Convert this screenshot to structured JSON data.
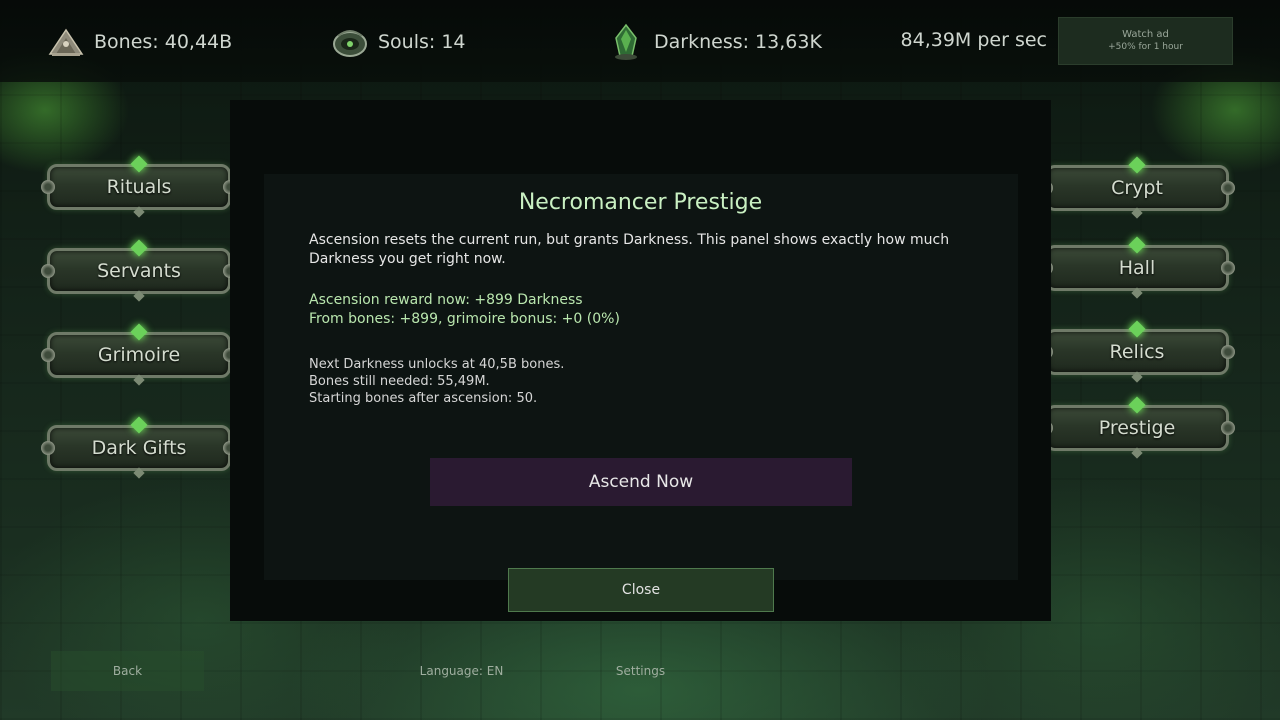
{
  "resources": {
    "bones": "Bones: 40,44B",
    "souls": "Souls: 14",
    "darkness": "Darkness: 13,63K",
    "per_sec": "84,39M per sec"
  },
  "watch_ad": {
    "line1": "Watch ad",
    "line2": "+50% for 1 hour"
  },
  "left_menu": [
    "Rituals",
    "Servants",
    "Grimoire",
    "Dark Gifts"
  ],
  "right_menu": [
    "Crypt",
    "Hall",
    "Relics",
    "Prestige"
  ],
  "modal": {
    "title": "Necromancer Prestige",
    "description": "Ascension resets the current run, but grants Darkness. This panel shows exactly how much Darkness you get right now.",
    "reward_line1": "Ascension reward now: +899 Darkness",
    "reward_line2": "From bones: +899, grimoire bonus: +0 (0%)",
    "info_line1": "Next Darkness unlocks at 40,5B bones.",
    "info_line2": "Bones still needed: 55,49M.",
    "info_line3": "Starting bones after ascension: 50.",
    "ascend_label": "Ascend Now",
    "close_label": "Close"
  },
  "bottom": {
    "back": "Back",
    "language": "Language: EN",
    "settings": "Settings"
  },
  "icons": {
    "bones": "bone-pile-icon",
    "souls": "soul-orb-icon",
    "darkness": "dark-crystal-icon"
  },
  "colors": {
    "accent_green": "#c9f0c2",
    "reward_green": "#b9e6ae",
    "ascend_bg": "#2a1a31",
    "close_bg": "#243a24"
  }
}
